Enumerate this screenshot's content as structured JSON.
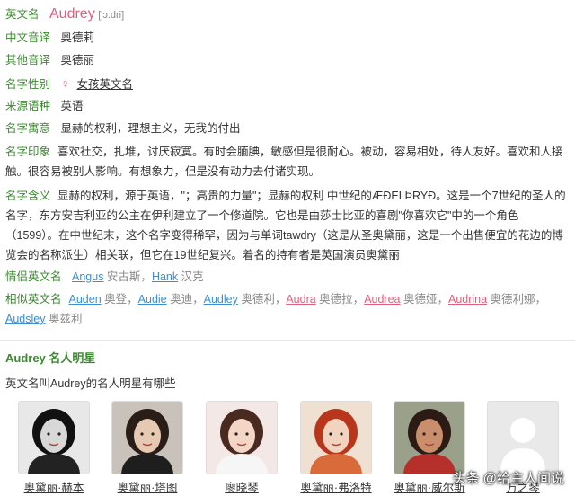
{
  "name": {
    "label": "英文名",
    "value": "Audrey",
    "pron": "['ɔ:dri]"
  },
  "cn_trans": {
    "label": "中文音译",
    "value": "奥德莉"
  },
  "other_trans": {
    "label": "其他音译",
    "value": "奥德丽"
  },
  "gender": {
    "label": "名字性别",
    "symbol": "♀",
    "value": "女孩英文名"
  },
  "origin": {
    "label": "来源语种",
    "value": "英语"
  },
  "meaning": {
    "label": "名字寓意",
    "value": "显赫的权利，理想主义，无我的付出"
  },
  "impression": {
    "label": "名字印象",
    "value": "喜欢社交，扎堆，讨厌寂寞。有时会腼腆，敏感但是很耐心。被动，容易相处，待人友好。喜欢和人接触。很容易被别人影响。有想象力，但是没有动力去付诸实现。"
  },
  "definition": {
    "label": "名字含义",
    "value": "显赫的权利，源于英语，\"；高贵的力量\"；显赫的权利 中世纪的ÆÐELÞRYÐ。这是一个7世纪的圣人的名字，东方安吉利亚的公主在伊利建立了一个修道院。它也是由莎士比亚的喜剧\"你喜欢它\"中的一个角色（1599）。在中世纪末，这个名字变得稀罕，因为与单词tawdry（这是从圣奥黛丽，这是一个出售便宜的花边的博览会的名称派生）相关联，但它在19世纪复兴。着名的持有者是英国演员奥黛丽"
  },
  "couple": {
    "label": "情侣英文名",
    "items": [
      {
        "name": "Angus",
        "cn": "安古斯"
      },
      {
        "name": "Hank",
        "cn": "汉克"
      }
    ]
  },
  "similar": {
    "label": "相似英文名",
    "items": [
      {
        "name": "Auden",
        "cn": "奥登",
        "color": "blue"
      },
      {
        "name": "Audie",
        "cn": "奥迪",
        "color": "blue"
      },
      {
        "name": "Audley",
        "cn": "奥德利",
        "color": "blue"
      },
      {
        "name": "Audra",
        "cn": "奥德拉",
        "color": "pink"
      },
      {
        "name": "Audrea",
        "cn": "奥德娅",
        "color": "pink"
      },
      {
        "name": "Audrina",
        "cn": "奥德利娜",
        "color": "pink"
      },
      {
        "name": "Audsley",
        "cn": "奥兹利",
        "color": "blue"
      }
    ]
  },
  "celebs_section": {
    "title": "Audrey 名人明星",
    "subtitle": "英文名叫Audrey的名人明星有哪些"
  },
  "celebs": [
    {
      "name": "奥黛丽·赫本",
      "photo": "bw"
    },
    {
      "name": "奥黛丽·塔图",
      "photo": "dark"
    },
    {
      "name": "廖晓琴",
      "photo": "smile"
    },
    {
      "name": "奥黛丽·弗洛特",
      "photo": "red"
    },
    {
      "name": "奥黛丽·威尔斯",
      "photo": "warm"
    },
    {
      "name": "万之琴",
      "photo": "placeholder"
    }
  ],
  "watermark": "头条 @给主人间说",
  "colors": {
    "label_green": "#3a8a2e",
    "link_blue": "#3b8fd0",
    "female_pink": "#e0607e"
  }
}
